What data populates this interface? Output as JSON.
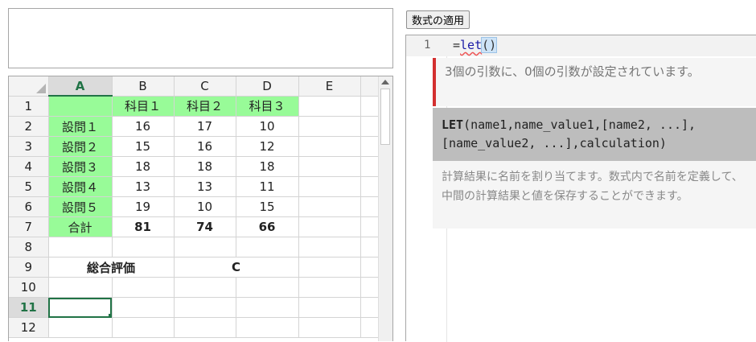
{
  "toolbar": {
    "apply_label": "数式の適用"
  },
  "sheet": {
    "col_headers": [
      "A",
      "B",
      "C",
      "D",
      "E"
    ],
    "row_headers": [
      "1",
      "2",
      "3",
      "4",
      "5",
      "6",
      "7",
      "8",
      "9",
      "10",
      "11",
      "12"
    ],
    "subjects": [
      "科目１",
      "科目２",
      "科目３"
    ],
    "questions": [
      {
        "label": "設問１",
        "values": [
          "16",
          "17",
          "10"
        ]
      },
      {
        "label": "設問２",
        "values": [
          "15",
          "16",
          "12"
        ]
      },
      {
        "label": "設問３",
        "values": [
          "18",
          "18",
          "18"
        ]
      },
      {
        "label": "設問４",
        "values": [
          "13",
          "13",
          "11"
        ]
      },
      {
        "label": "設問５",
        "values": [
          "19",
          "10",
          "15"
        ]
      }
    ],
    "total_label": "合計",
    "totals": [
      "81",
      "74",
      "66"
    ],
    "evaluation_label": "総合評価",
    "evaluation_value": "C",
    "active_cell": "A11",
    "colors": {
      "label_fill": "#98fb98",
      "evaluation": "#ee0000",
      "selection": "#217346"
    }
  },
  "editor": {
    "line_number": "1",
    "code_prefix": "=",
    "code_func": "let",
    "code_parens": "()",
    "diagnostic": "3個の引数に、0個の引数が設定されています。",
    "signature_name": "LET",
    "signature_line1": "(name1,name_value1,[name2, ...],",
    "signature_line2": "[name_value2, ...],calculation)",
    "description": "計算結果に名前を割り当てます。数式内で名前を定義して、中間の計算結果と値を保存することができます。",
    "colors": {
      "error_bar": "#d32f2f",
      "signature_bg": "#bdbdbd",
      "function": "#1a1aa6"
    }
  }
}
